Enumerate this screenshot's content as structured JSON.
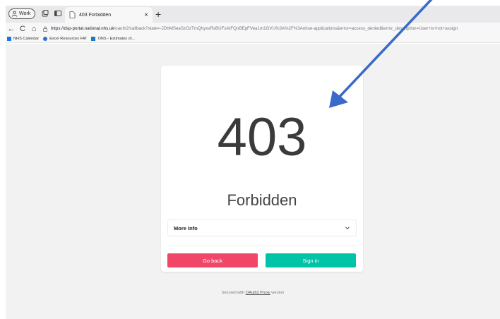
{
  "browser": {
    "profile_label": "Work",
    "tab_title": "403 Forbidden",
    "tab_close": "×",
    "new_tab": "+",
    "url_host": "https://dsp-portal.national.nhs.uk",
    "url_path": "/oauth2/callback?state=-JDhMSeaSzOzTmQhyxvRsBUFsAIFQnBEpFVea1m1GVU%3A%2F%3Anhse-applications&error=access_denied&error_description=User+is+not+assign",
    "nav": {
      "back": "←",
      "refresh": "C",
      "home": "⌂"
    },
    "bookmarks": [
      {
        "label": "NHS Calendar",
        "icon": "calendar-icon",
        "color": "#1a73e8"
      },
      {
        "label": "Excel Resources FAT",
        "icon": "globe-icon",
        "color": "#2a6fd6"
      },
      {
        "label": "ONS - Estimates of...",
        "icon": "chart-icon",
        "color": "#1b8a5a"
      }
    ]
  },
  "card": {
    "code": "403",
    "status": "Forbidden",
    "more_info_label": "More Info",
    "back_button": "Go back",
    "signin_button": "Sign in"
  },
  "footer": {
    "prefix": "Secured with ",
    "link": "OAuth2 Proxy",
    "suffix": " version"
  },
  "colors": {
    "go_back": "#f14668",
    "sign_in": "#00c4a7",
    "annotation_arrow": "#3a6ac8"
  }
}
